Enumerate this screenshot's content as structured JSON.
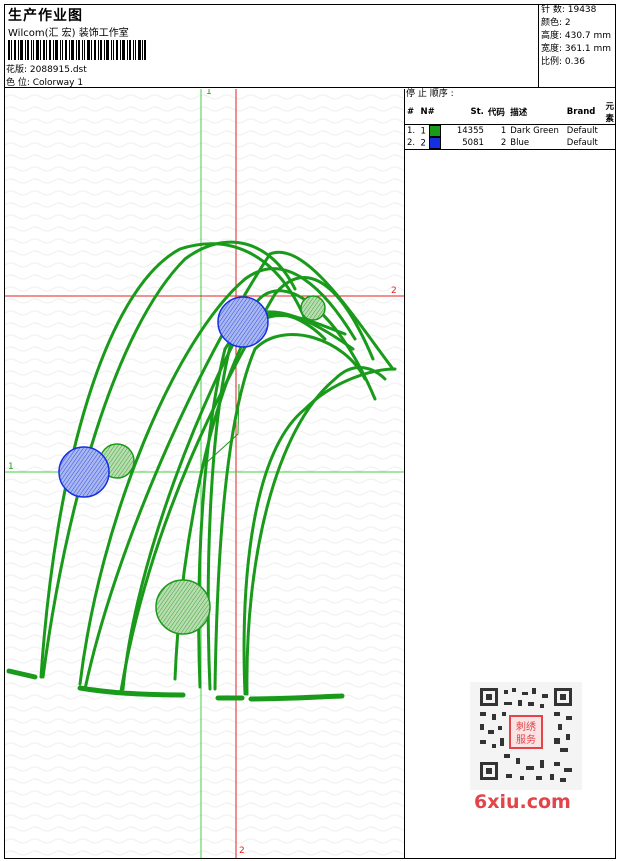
{
  "header": {
    "title": "生产作业图",
    "company": "Wilcom(汇 宏) 装饰工作室",
    "design_label": "花版: 2088915.dst",
    "colorway_label": "色 位: Colorway 1"
  },
  "stats": {
    "stitches": "针 数: 19438",
    "colors": "颜色: 2",
    "height": "高度: 430.7 mm",
    "width": "宽度: 361.1 mm",
    "scale": "比例: 0.36"
  },
  "stop_sequence": {
    "title": "停 止 顺序 :",
    "columns": [
      "#",
      "N#",
      "St.",
      "代码",
      "描述",
      "Brand",
      "元素"
    ],
    "rows": [
      {
        "idx": "1.",
        "n": "1",
        "color": "#1a9a1a",
        "stitches": "14355",
        "code": "1",
        "desc": "Dark Green",
        "brand": "Default"
      },
      {
        "idx": "2.",
        "n": "2",
        "color": "#1530e0",
        "stitches": "5081",
        "code": "2",
        "desc": "Blue",
        "brand": "Default"
      }
    ]
  },
  "axis_labels": {
    "v1": "1",
    "h2": "2",
    "h1": "1",
    "v2": "2"
  },
  "colors": {
    "green": "#1a9a1a",
    "blue": "#1530e0",
    "guide_green": "#40d040",
    "guide_red": "#e02020"
  },
  "watermark": {
    "brand": "6xiu.com",
    "qr_text": "刺绣\n服务"
  }
}
